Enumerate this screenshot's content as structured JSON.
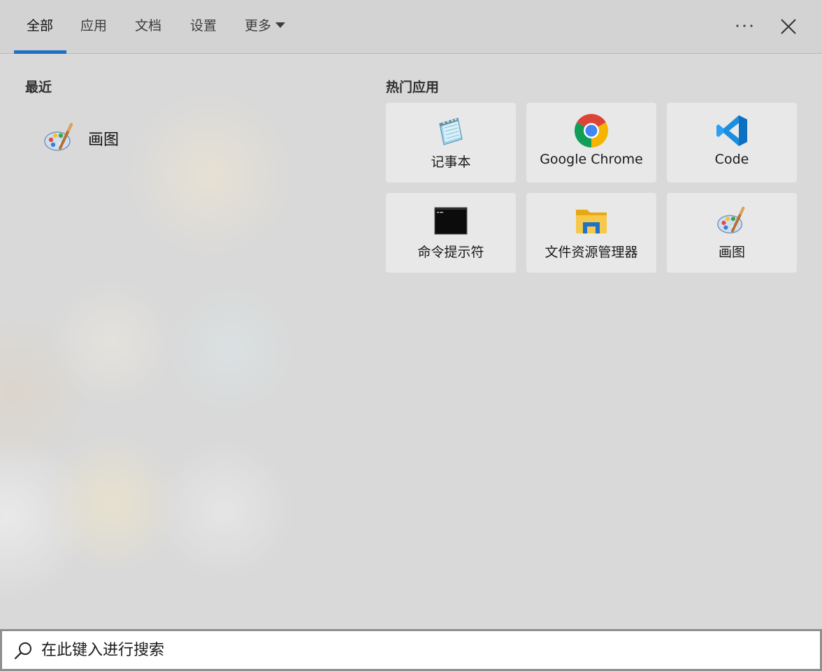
{
  "tabs": [
    {
      "label": "全部",
      "active": true
    },
    {
      "label": "应用",
      "active": false
    },
    {
      "label": "文档",
      "active": false
    },
    {
      "label": "设置",
      "active": false
    },
    {
      "label": "更多",
      "active": false,
      "has_dropdown": true
    }
  ],
  "header_actions": {
    "more_icon": "more-options-icon",
    "close_icon": "close-icon"
  },
  "recent": {
    "title": "最近",
    "items": [
      {
        "label": "画图",
        "icon": "paint-icon"
      }
    ]
  },
  "top_apps": {
    "title": "热门应用",
    "items": [
      {
        "label": "记事本",
        "icon": "notepad-icon"
      },
      {
        "label": "Google Chrome",
        "icon": "chrome-icon"
      },
      {
        "label": "Code",
        "icon": "vscode-icon"
      },
      {
        "label": "命令提示符",
        "icon": "command-prompt-icon"
      },
      {
        "label": "文件资源管理器",
        "icon": "file-explorer-icon"
      },
      {
        "label": "画图",
        "icon": "paint-icon"
      }
    ]
  },
  "search": {
    "value": "",
    "placeholder": "在此键入进行搜索",
    "icon": "search-icon"
  },
  "colors": {
    "accent": "#1f6fc4",
    "background": "#d9d9d9",
    "tile": "#eaeaea"
  }
}
